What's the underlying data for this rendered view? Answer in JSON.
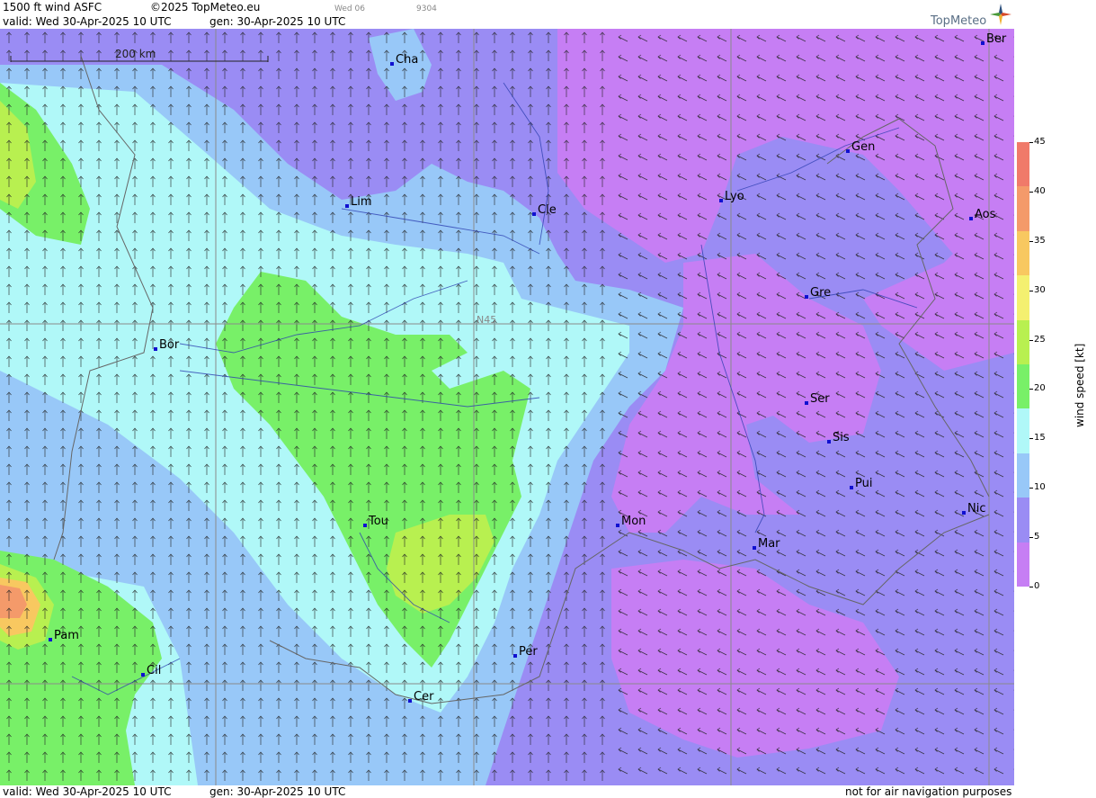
{
  "header": {
    "product": "1500 ft wind ASFC",
    "copyright": "©2025 TopMeteo.eu",
    "valid": "valid:  Wed  30-Apr-2025  10 UTC",
    "gen": "gen:  30-Apr-2025  10 UTC",
    "time_small": "Wed 06",
    "code_small": "9304"
  },
  "logo": {
    "text": "TopMeteo"
  },
  "map": {
    "scale_label": "200 km",
    "lat_label": "N45",
    "cities": [
      {
        "name": "Cha"
      },
      {
        "name": "Ber"
      },
      {
        "name": "Gen"
      },
      {
        "name": "Lyo"
      },
      {
        "name": "Lim"
      },
      {
        "name": "Cle"
      },
      {
        "name": "Aos"
      },
      {
        "name": "Gre"
      },
      {
        "name": "Bor"
      },
      {
        "name": "Ser"
      },
      {
        "name": "Sis"
      },
      {
        "name": "Pui"
      },
      {
        "name": "Tou"
      },
      {
        "name": "Mon"
      },
      {
        "name": "Nic"
      },
      {
        "name": "Mar"
      },
      {
        "name": "Pam"
      },
      {
        "name": "Per"
      },
      {
        "name": "Cil"
      },
      {
        "name": "Cer"
      }
    ]
  },
  "legend": {
    "unit": "wind speed [kt]",
    "ticks": [
      "45",
      "40",
      "35",
      "30",
      "25",
      "20",
      "15",
      "10",
      "5",
      "0"
    ],
    "colors": [
      "#f07a6a",
      "#f49a6a",
      "#f8c860",
      "#f4f070",
      "#b8f050",
      "#78f068",
      "#b0f8f8",
      "#98c8f8",
      "#9a8cf4",
      "#c67ef4"
    ]
  },
  "footer": {
    "valid": "valid:  Wed  30-Apr-2025  10 UTC",
    "gen": "gen:  30-Apr-2025  10 UTC",
    "disclaimer": "not for air navigation purposes"
  }
}
